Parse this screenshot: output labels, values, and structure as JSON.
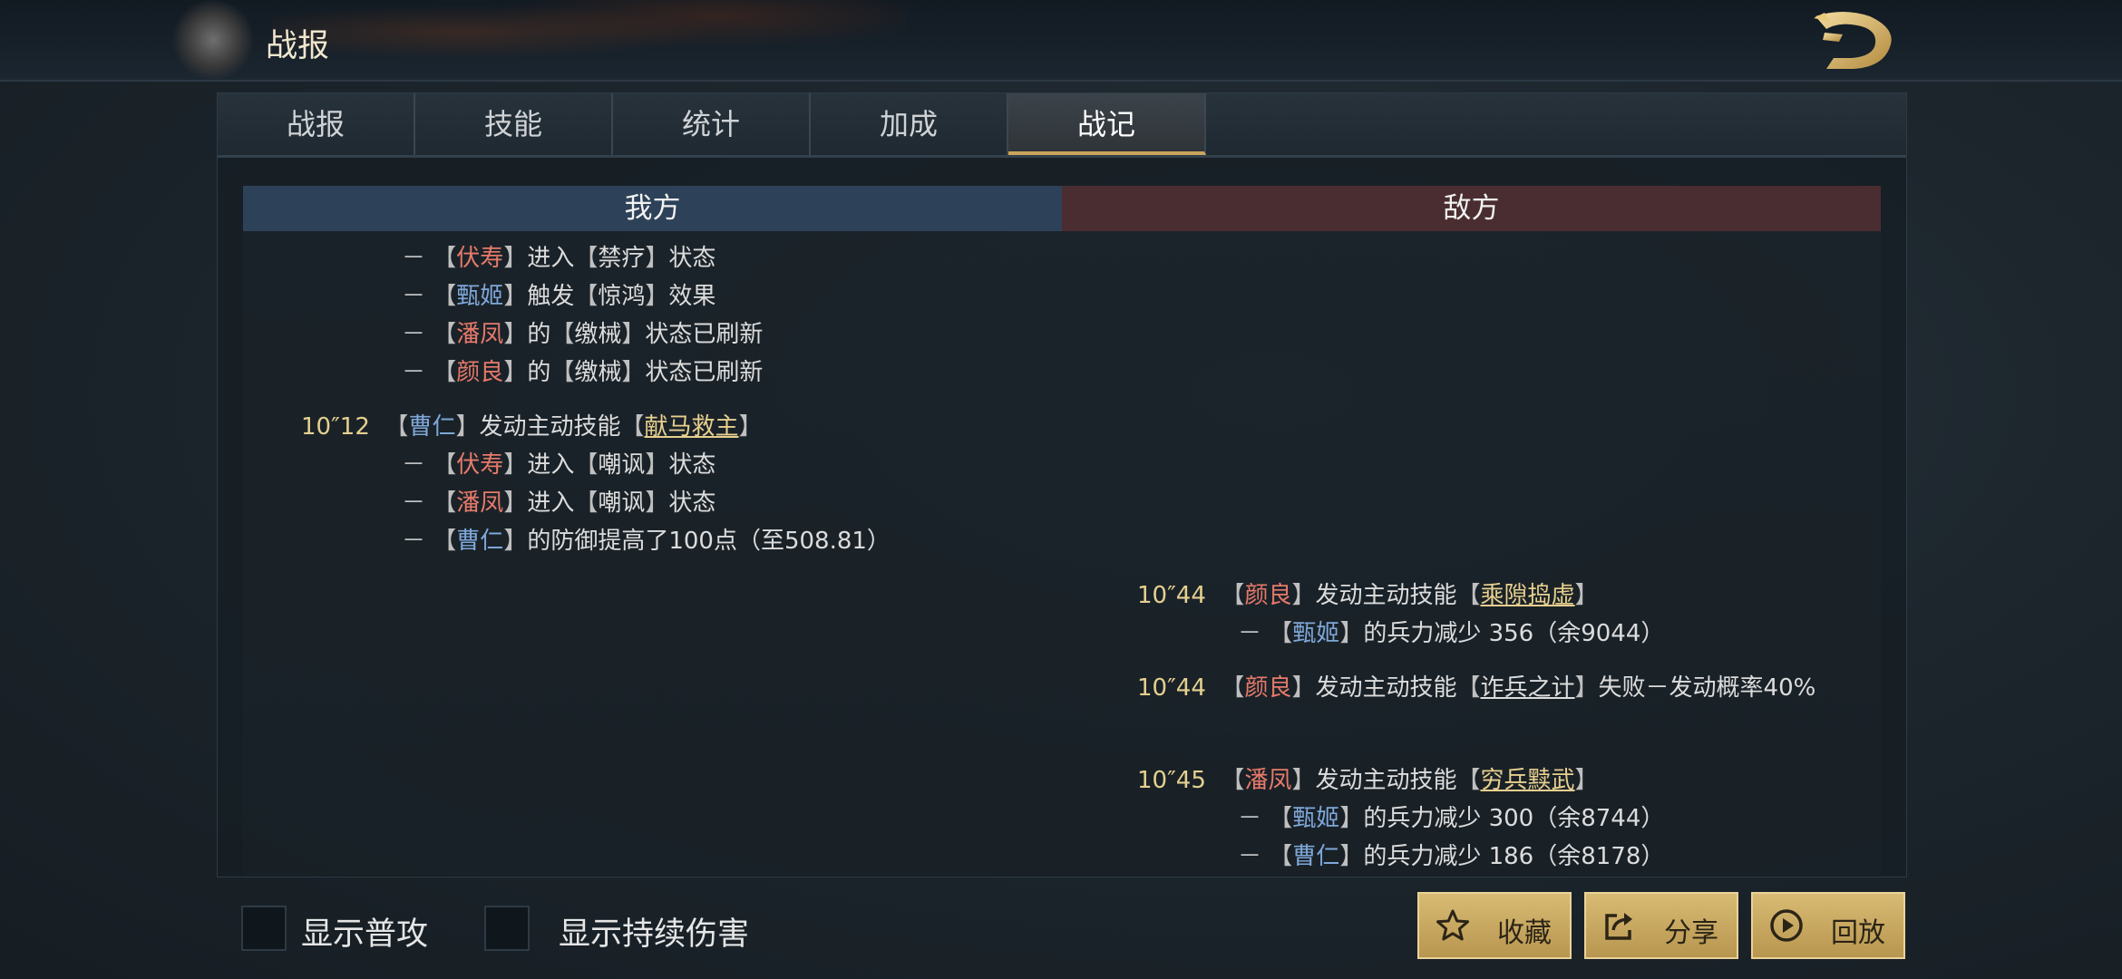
{
  "header": {
    "title": "战报",
    "logo_icon": "dragon-logo-icon"
  },
  "tabs": [
    {
      "label": "战报",
      "active": false
    },
    {
      "label": "技能",
      "active": false
    },
    {
      "label": "统计",
      "active": false
    },
    {
      "label": "加成",
      "active": false
    },
    {
      "label": "战记",
      "active": true
    }
  ],
  "columns": {
    "our": "我方",
    "enemy": "敌方"
  },
  "log": {
    "our": {
      "l1": {
        "dash": "－",
        "name": "伏寿",
        "mid": "进入",
        "state": "禁疗",
        "tail": "状态"
      },
      "l2": {
        "dash": "－",
        "name": "甄姬",
        "mid": "触发",
        "state": "惊鸿",
        "tail": "效果"
      },
      "l3": {
        "dash": "－",
        "name": "潘凤",
        "mid": "的",
        "state": "缴械",
        "tail": "状态已刷新"
      },
      "l4": {
        "dash": "－",
        "name": "颜良",
        "mid": "的",
        "state": "缴械",
        "tail": "状态已刷新"
      },
      "e1": {
        "time": "10″12",
        "name": "曹仁",
        "mid": "发动主动技能",
        "skill": "献马救主"
      },
      "l5": {
        "dash": "－",
        "name": "伏寿",
        "mid": "进入",
        "state": "嘲讽",
        "tail": "状态"
      },
      "l6": {
        "dash": "－",
        "name": "潘凤",
        "mid": "进入",
        "state": "嘲讽",
        "tail": "状态"
      },
      "l7": {
        "dash": "－",
        "name": "曹仁",
        "text": "的防御提高了100点（至508.81）"
      }
    },
    "enemy": {
      "e1": {
        "time": "10″44",
        "name": "颜良",
        "mid": "发动主动技能",
        "skill": "乘隙捣虚"
      },
      "l1": {
        "dash": "－",
        "name": "甄姬",
        "text": "的兵力减少 356（余9044）"
      },
      "e2": {
        "time": "10″44",
        "name": "颜良",
        "mid": "发动主动技能",
        "skill": "诈兵之计",
        "tail": "失败－发动概率40%"
      },
      "e3": {
        "time": "10″45",
        "name": "潘凤",
        "mid": "发动主动技能",
        "skill": "穷兵黩武"
      },
      "l2": {
        "dash": "－",
        "name": "甄姬",
        "text": "的兵力减少 300（余8744）"
      },
      "l3": {
        "dash": "－",
        "name": "曹仁",
        "text": "的兵力减少 186（余8178）"
      }
    }
  },
  "footer": {
    "show_normal_attack": "显示普攻",
    "show_dot": "显示持续伤害",
    "favorite": "收藏",
    "share": "分享",
    "replay": "回放"
  },
  "colors": {
    "accent_gold": "#c9a65a",
    "ally": "#7fa7d8",
    "enemy": "#e77a6a",
    "skill": "#e7cf8e"
  }
}
